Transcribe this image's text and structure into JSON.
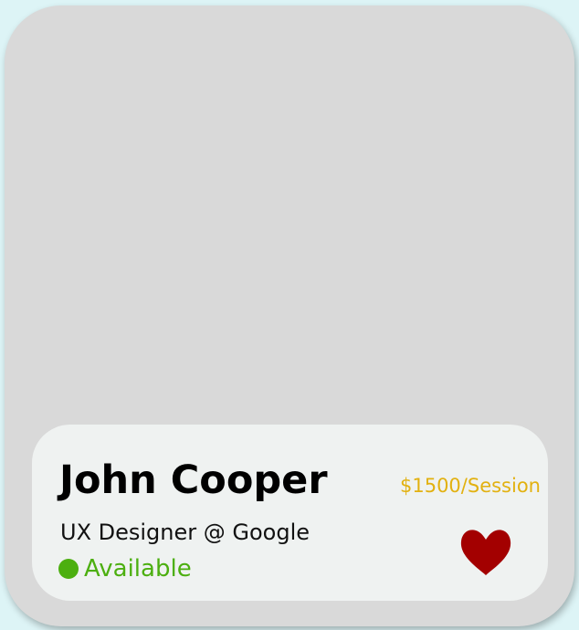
{
  "profile": {
    "name": "John Cooper",
    "role": "UX Designer @ Google",
    "status": "Available",
    "price": "$1500/Session"
  },
  "colors": {
    "background": "#ddf4f6",
    "card": "#d9d9d9",
    "panel": "#eff2f1",
    "price": "#e2b110",
    "available": "#4caf10",
    "heart": "#a30000"
  },
  "icons": {
    "favorite": "heart-icon",
    "status": "status-dot-icon"
  }
}
